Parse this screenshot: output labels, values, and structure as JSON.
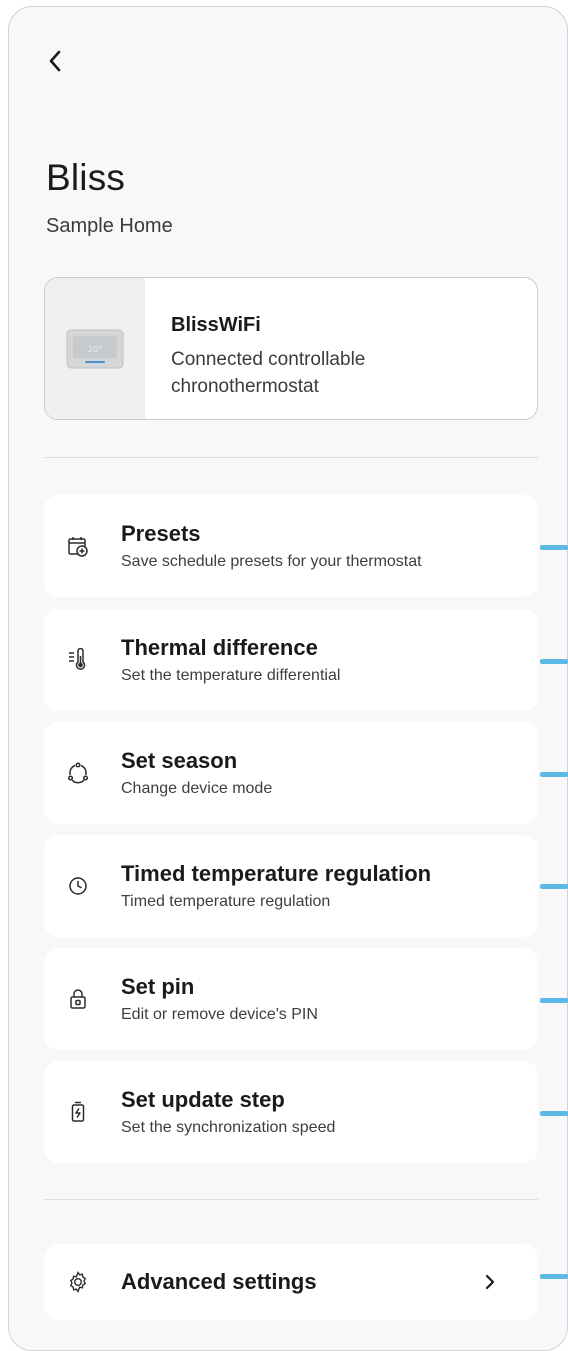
{
  "header": {
    "title": "Bliss",
    "subtitle": "Sample Home"
  },
  "device": {
    "name": "BlissWiFi",
    "description": "Connected controllable chronothermostat",
    "icon": "thermostat-image"
  },
  "menu": [
    {
      "id": "presets",
      "label": "Presets",
      "description": "Save schedule presets for your thermostat",
      "icon": "calendar-plus-icon"
    },
    {
      "id": "thermal-difference",
      "label": "Thermal difference",
      "description": "Set the temperature differential",
      "icon": "thermometer-icon"
    },
    {
      "id": "set-season",
      "label": "Set season",
      "description": "Change device mode",
      "icon": "season-cycle-icon"
    },
    {
      "id": "timed-regulation",
      "label": "Timed temperature regulation",
      "description": "Timed temperature regulation",
      "icon": "clock-icon"
    },
    {
      "id": "set-pin",
      "label": "Set pin",
      "description": "Edit or remove device's PIN",
      "icon": "lock-icon"
    },
    {
      "id": "update-step",
      "label": "Set update step",
      "description": "Set the synchronization speed",
      "icon": "battery-bolt-icon"
    }
  ],
  "advanced": {
    "label": "Advanced settings",
    "icon": "gear-icon"
  },
  "colors": {
    "accent_mark": "#5cb8e6",
    "card_background": "#ffffff",
    "page_background": "#f8f8f8"
  }
}
